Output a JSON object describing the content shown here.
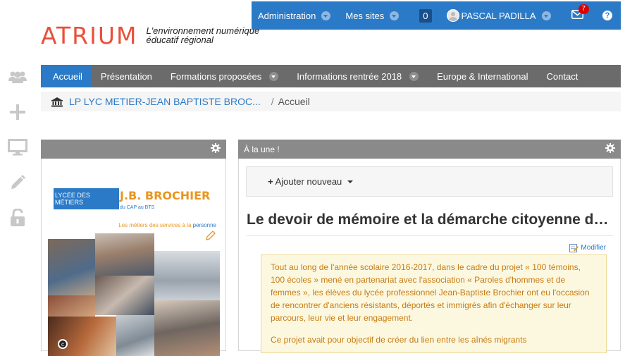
{
  "topbar": {
    "admin_label": "Administration",
    "sites_label": "Mes sites",
    "count": "0",
    "user_name": "PASCAL PADILLA",
    "mail_count": "7",
    "help_label": "?"
  },
  "logo": {
    "word": "ATRIUM",
    "tagline_1": "L'environnement numérique",
    "tagline_2": "éducatif régional"
  },
  "menu": {
    "items": [
      {
        "label": "Accueil"
      },
      {
        "label": "Présentation"
      },
      {
        "label": "Formations proposées"
      },
      {
        "label": "Informations rentrée 2018"
      },
      {
        "label": "Europe & International"
      },
      {
        "label": "Contact"
      }
    ]
  },
  "breadcrumb": {
    "school": "LP LYC METIER-JEAN BAPTISTE BROC...",
    "sep": "/",
    "current": "Accueil"
  },
  "left_panel": {
    "poster": {
      "tag": "LYCÉE DES MÉTIERS",
      "name": "J.B. BROCHIER",
      "sub": "du CAP au BTS",
      "line_a": "Les métiers des services à la",
      "line_b": "personne"
    }
  },
  "right_panel": {
    "title": "À la une !",
    "add_label": "Ajouter nouveau",
    "article_title": "Le devoir de mémoire et la démarche citoyenne des élèves",
    "modify_label": "Modifier",
    "p1": "Tout au long de l'année scolaire 2016-2017, dans le cadre du projet « 100 témoins, 100 écoles » mené en partenariat avec l'association « Paroles d'hommes et de femmes », les élèves du lycée professionnel Jean-Baptiste Brochier ont eu l'occasion de rencontrer d'anciens résistants, déportés et immigrés afin d'échanger sur leur parcours, leur vie et leur engagement.",
    "p2": "Ce projet avait pour objectif de créer du lien entre les aînés migrants"
  },
  "colors": {
    "blue": "#2a7ac7",
    "grey_menu": "#6b6b6b",
    "logo_red": "#e9503a",
    "orange": "#e8961e"
  }
}
